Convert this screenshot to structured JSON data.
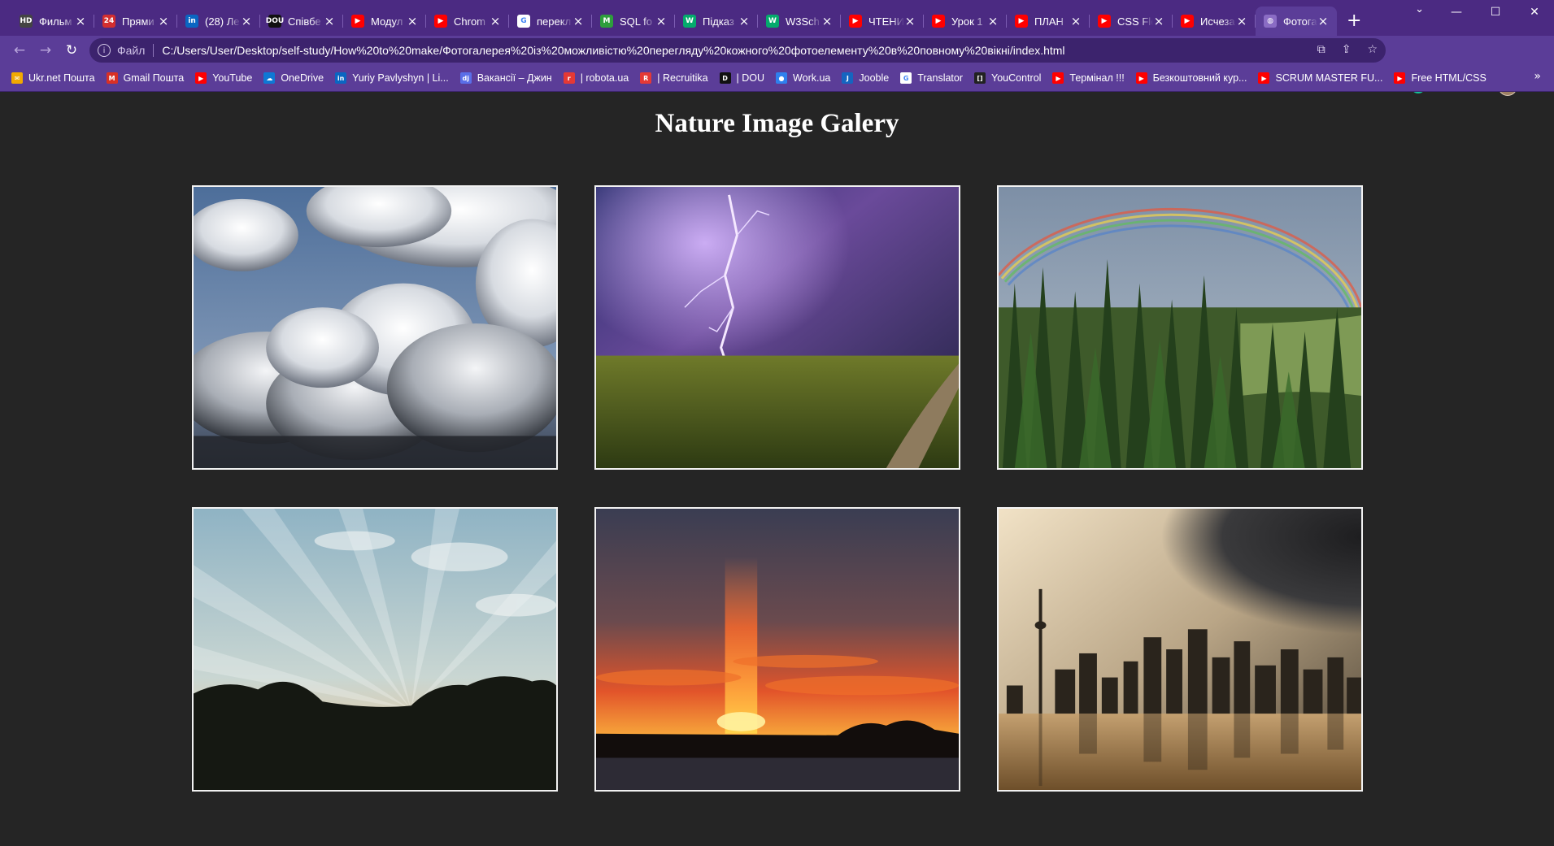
{
  "browser": {
    "tabs": [
      {
        "label": "Фильм",
        "icon": "hd-icon",
        "color": "#444444",
        "glyph": "HD"
      },
      {
        "label": "Прями",
        "icon": "24-channel-icon",
        "color": "#d32f2f",
        "glyph": "24"
      },
      {
        "label": "(28) Ле",
        "icon": "linkedin-icon",
        "color": "#0a66c2",
        "glyph": "in"
      },
      {
        "label": "Співбе",
        "icon": "dou-icon",
        "color": "#111111",
        "glyph": "DOU"
      },
      {
        "label": "Модул",
        "icon": "youtube-icon",
        "color": "#ff0000",
        "glyph": "▶"
      },
      {
        "label": "Chrom",
        "icon": "youtube-icon",
        "color": "#ff0000",
        "glyph": "▶"
      },
      {
        "label": "перекл",
        "icon": "google-icon",
        "color": "#ffffff",
        "glyph": "G"
      },
      {
        "label": "SQL fo",
        "icon": "m-icon",
        "color": "#2e9e3c",
        "glyph": "M"
      },
      {
        "label": "Підказ",
        "icon": "w3-icon",
        "color": "#04aa6d",
        "glyph": "W"
      },
      {
        "label": "W3Sch",
        "icon": "w3-icon",
        "color": "#04aa6d",
        "glyph": "W"
      },
      {
        "label": "ЧТЕНИ",
        "icon": "youtube-icon",
        "color": "#ff0000",
        "glyph": "▶"
      },
      {
        "label": "Урок 1",
        "icon": "youtube-icon",
        "color": "#ff0000",
        "glyph": "▶"
      },
      {
        "label": "ПЛАН",
        "icon": "youtube-icon",
        "color": "#ff0000",
        "glyph": "▶"
      },
      {
        "label": "CSS Fle",
        "icon": "youtube-icon",
        "color": "#ff0000",
        "glyph": "▶"
      },
      {
        "label": "Исчеза",
        "icon": "youtube-icon",
        "color": "#ff0000",
        "glyph": "▶"
      },
      {
        "label": "Фотога",
        "icon": "globe-icon",
        "color": "#8a6cc4",
        "glyph": "◍",
        "active": true
      }
    ],
    "new_tab": "+",
    "address": {
      "scheme": "Файл",
      "url": "C:/Users/User/Desktop/self-study/How%20to%20make/Фотогалерея%20із%20можливістю%20перегляду%20кожного%20фотоелементу%20в%20повному%20вікні/index.html"
    },
    "bookmarks": [
      {
        "label": "Ukr.net Пошта",
        "icon": "ukrnet-icon",
        "color": "#f2a900",
        "glyph": "✉"
      },
      {
        "label": "Gmail Пошта",
        "icon": "gmail-icon",
        "color": "#d93025",
        "glyph": "M"
      },
      {
        "label": "YouTube",
        "icon": "youtube-icon",
        "color": "#ff0000",
        "glyph": "▶"
      },
      {
        "label": "OneDrive",
        "icon": "onedrive-icon",
        "color": "#0f78d4",
        "glyph": "☁"
      },
      {
        "label": "Yuriy Pavlyshyn | Li...",
        "icon": "linkedin-icon",
        "color": "#0a66c2",
        "glyph": "in"
      },
      {
        "label": "Вакансії – Джин",
        "icon": "djinni-icon",
        "color": "#5a6ee8",
        "glyph": "dj"
      },
      {
        "label": "| robota.ua",
        "icon": "robota-icon",
        "color": "#e53935",
        "glyph": "r"
      },
      {
        "label": "| Recruitika",
        "icon": "recruitika-icon",
        "color": "#e53935",
        "glyph": "R"
      },
      {
        "label": "| DOU",
        "icon": "dou-icon",
        "color": "#111111",
        "glyph": "D"
      },
      {
        "label": "Work.ua",
        "icon": "workua-icon",
        "color": "#2f80ed",
        "glyph": "●"
      },
      {
        "label": "Jooble",
        "icon": "jooble-icon",
        "color": "#1565c0",
        "glyph": "J"
      },
      {
        "label": "Translator",
        "icon": "google-icon",
        "color": "#ffffff",
        "glyph": "G"
      },
      {
        "label": "YouControl",
        "icon": "youcontrol-icon",
        "color": "#222222",
        "glyph": "[]"
      },
      {
        "label": "Термінал !!!",
        "icon": "youtube-icon",
        "color": "#ff0000",
        "glyph": "▶"
      },
      {
        "label": "Безкоштовний кур...",
        "icon": "youtube-icon",
        "color": "#ff0000",
        "glyph": "▶"
      },
      {
        "label": "SCRUM MASTER FU...",
        "icon": "youtube-icon",
        "color": "#ff0000",
        "glyph": "▶"
      },
      {
        "label": "Free HTML/CSS",
        "icon": "youtube-icon",
        "color": "#ff0000",
        "glyph": "▶"
      }
    ]
  },
  "page": {
    "title": "Nature Image Galery",
    "photos": [
      {
        "name": "photo-clouds",
        "alt": "Cumulus clouds in blue sky"
      },
      {
        "name": "photo-lightning",
        "alt": "Lightning over a wheat field"
      },
      {
        "name": "photo-rainbow-forest",
        "alt": "Rainbow over a pine forest"
      },
      {
        "name": "photo-sun-rays",
        "alt": "Sun rays over a highway"
      },
      {
        "name": "photo-sunset-pillar",
        "alt": "Sun pillar at sunset"
      },
      {
        "name": "photo-storm-city",
        "alt": "Storm clouds over a city skyline"
      }
    ]
  },
  "colors": {
    "chrome": "#5b3d98",
    "tabstrip": "#4b2a82",
    "page_background": "#252525",
    "photo_border": "#f2f2f2"
  }
}
